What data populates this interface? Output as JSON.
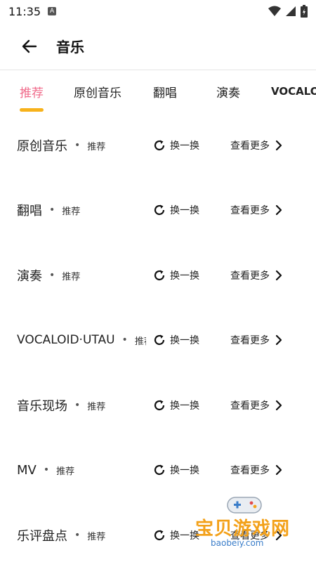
{
  "status": {
    "time": "11:35",
    "badge": "A"
  },
  "header": {
    "title": "音乐"
  },
  "tabs": [
    {
      "label": "推荐"
    },
    {
      "label": "原创音乐"
    },
    {
      "label": "翻唱"
    },
    {
      "label": "演奏"
    },
    {
      "label": "VOCALOID·UTAU"
    }
  ],
  "sections": [
    {
      "title": "原创音乐",
      "tag": "推荐",
      "refresh": "换一换",
      "more": "查看更多"
    },
    {
      "title": "翻唱",
      "tag": "推荐",
      "refresh": "换一换",
      "more": "查看更多"
    },
    {
      "title": "演奏",
      "tag": "推荐",
      "refresh": "换一换",
      "more": "查看更多"
    },
    {
      "title": "VOCALOID·UTAU",
      "tag": "推荐",
      "refresh": "换一换",
      "more": "查看更多"
    },
    {
      "title": "音乐现场",
      "tag": "推荐",
      "refresh": "换一换",
      "more": "查看更多"
    },
    {
      "title": "MV",
      "tag": "推荐",
      "refresh": "换一换",
      "more": "查看更多"
    },
    {
      "title": "乐评盘点",
      "tag": "推荐",
      "refresh": "换一换",
      "more": "查看更多"
    }
  ],
  "watermark": {
    "name": "宝贝游戏网",
    "url": "baobeiy.com"
  },
  "colors": {
    "active_tab": "#f06a8a",
    "indicator": "#f7b21b"
  }
}
